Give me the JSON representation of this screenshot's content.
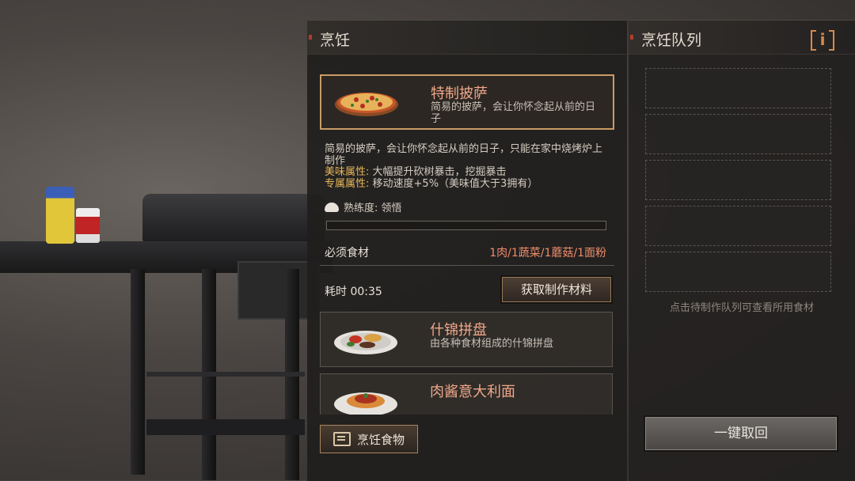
{
  "cook_panel": {
    "title": "烹饪",
    "recipes": [
      {
        "name": "特制披萨",
        "desc": "简易的披萨，会让你怀念起从前的日子",
        "image_icon": "pizza-icon"
      },
      {
        "name": "什锦拼盘",
        "desc": "由各种食材组成的什锦拼盘",
        "image_icon": "platter-icon"
      },
      {
        "name": "肉酱意大利面",
        "desc": "",
        "image_icon": "spaghetti-icon"
      }
    ],
    "detail": {
      "description": "简易的披萨，会让你怀念起从前的日子，只能在家中烧烤炉上制作",
      "taste_key": "美味属性:",
      "taste_value": "大幅提升砍树暴击，挖掘暴击",
      "exclusive_key": "专属属性:",
      "exclusive_value": "移动速度+5%（美味值大于3拥有）",
      "mastery_label": "熟练度: 领悟",
      "mastery_progress": 0,
      "ingredients_label": "必须食材",
      "ingredients_value": "1肉/1蔬菜/1蘑菇/1面粉",
      "time_label": "耗时 00:35",
      "get_materials_label": "获取制作材料"
    },
    "cook_button_label": "烹饪食物"
  },
  "queue_panel": {
    "title": "烹饪队列",
    "info_label": "i",
    "slots": 5,
    "hint": "点击待制作队列可查看所用食材",
    "recall_label": "一键取回"
  },
  "colors": {
    "accent": "#c99c64",
    "recipe_name": "#f0a88a",
    "attr_key": "#e5b55a",
    "ingredient": "#ef8c6a"
  }
}
